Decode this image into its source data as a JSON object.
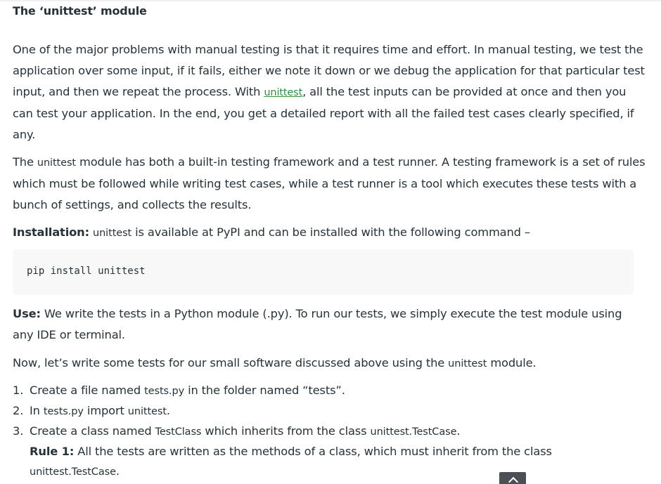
{
  "heading": "The ‘unittest’ module",
  "para1": {
    "before_link": "One of the major problems with manual testing is that it requires time and effort. In manual testing, we test the application over some input, if it fails, either we note it down or we debug the application for that particular test input, and then we repeat the process. With ",
    "link": "unittest",
    "after_link": ", all the test inputs can be provided at once and then you can test your application. In the end, you get a detailed report with all the failed test cases clearly specified, if any."
  },
  "para2": {
    "lead": "The ",
    "code": "unittest",
    "rest": " module has both a built-in testing framework and a test runner. A testing framework is a set of rules which must be followed while writing test cases, while a test runner is a tool which executes these tests with a bunch of settings, and collects the results."
  },
  "para3": {
    "label": "Installation:",
    "code": "unittest",
    "rest": " is available at PyPI and can be installed with the following command –"
  },
  "code_block": "pip install unittest",
  "para4": {
    "label": "Use:",
    "rest": " We write the tests in a Python module (.py). To run our tests, we simply execute the test module using any IDE or terminal."
  },
  "para5": {
    "lead": "Now, let’s write some tests for our small software discussed above using the ",
    "code": "unittest",
    "rest": " module."
  },
  "list": {
    "item1": {
      "num": "1.",
      "a": "Create a file named ",
      "code": "tests.py",
      "b": " in the folder named “tests”."
    },
    "item2": {
      "num": "2.",
      "a": "In ",
      "code1": "tests.py",
      "b": " import ",
      "code2": "unittest",
      "c": "."
    },
    "item3": {
      "num": "3.",
      "a": "Create a class named ",
      "code1": "TestClass",
      "b": " which inherits from the class ",
      "code2": "unittest.TestCase",
      "c": "."
    },
    "rule1": {
      "label": "Rule 1:",
      "text": " All the tests are written as the methods of a class, which must inherit from the class",
      "code": "unittest.TestCase",
      "end": "."
    }
  }
}
